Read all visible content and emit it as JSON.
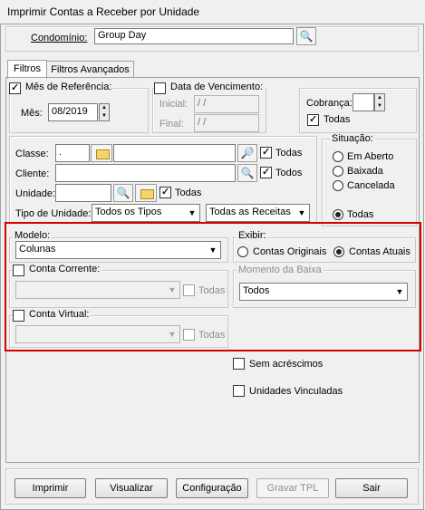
{
  "window": {
    "title": "Imprimir Contas a Receber por Unidade"
  },
  "condominio": {
    "label": "Condomínio:",
    "value": "Group Day"
  },
  "tabs": [
    {
      "label": "Filtros"
    },
    {
      "label": "Filtros Avançados"
    }
  ],
  "mes_ref": {
    "label": "Mês de Referência:",
    "mes_label": "Mês:",
    "mes_value": "08/2019"
  },
  "vencimento": {
    "label": "Data de Vencimento:",
    "inicial_label": "Inicial:",
    "inicial_value": "/ /",
    "final_label": "Final:",
    "final_value": "/ /"
  },
  "cobranca": {
    "label": "Cobrança:",
    "todas_label": "Todas"
  },
  "filters": {
    "classe_label": "Classe:",
    "classe_value": ".",
    "classe_todas": "Todas",
    "cliente_label": "Cliente:",
    "cliente_todos": "Todos",
    "unidade_label": "Unidade:",
    "unidade_todas": "Todas",
    "tipo_label": "Tipo de Unidade:",
    "tipo_value": "Todos os Tipos",
    "receitas_value": "Todas as Receitas"
  },
  "situacao": {
    "label": "Situação:",
    "options": [
      "Em Aberto",
      "Baixada",
      "Cancelada",
      "Todas"
    ]
  },
  "modelo": {
    "label": "Modelo:",
    "value": "Colunas"
  },
  "exibir": {
    "label": "Exibir:",
    "options": [
      "Contas Originais",
      "Contas Atuais"
    ]
  },
  "conta_corrente": {
    "label": "Conta Corrente:",
    "todas": "Todas"
  },
  "momento_baixa": {
    "label": "Momento da Baixa",
    "value": "Todos"
  },
  "conta_virtual": {
    "label": "Conta Virtual:",
    "todas": "Todas"
  },
  "options": {
    "sem_acrescimos": "Sem acréscimos",
    "unidades_vinculadas": "Unidades Vinculadas"
  },
  "buttons": {
    "imprimir": "Imprimir",
    "visualizar": "Visualizar",
    "configuracao": "Configuração",
    "gravar": "Gravar TPL",
    "sair": "Sair"
  }
}
